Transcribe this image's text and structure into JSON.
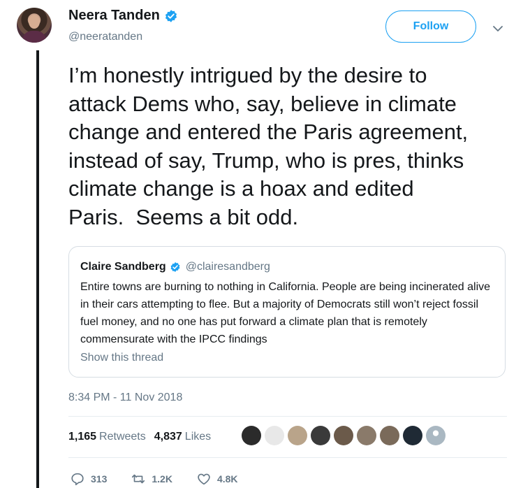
{
  "author": {
    "name": "Neera Tanden",
    "handle": "@neeratanden"
  },
  "follow_label": "Follow",
  "tweet_text": "I’m honestly intrigued by the desire to\nattack Dems who, say, believe in climate\nchange and entered the Paris agreement,\ninstead of say, Trump, who is pres, thinks\nclimate change is a hoax and edited\nParis.  Seems a bit odd.",
  "quote": {
    "name": "Claire Sandberg",
    "handle": "@clairesandberg",
    "text": "Entire towns are burning to nothing in California. People are being incinerated alive in their cars attempting to flee. But a majority of Democrats still won’t reject fossil fuel money, and no one has put forward a climate plan that is remotely commensurate with the IPCC findings",
    "thread_link": "Show this thread"
  },
  "timestamp": "8:34 PM - 11 Nov 2018",
  "stats": {
    "retweets_count": "1,165",
    "retweets_label": "Retweets",
    "likes_count": "4,837",
    "likes_label": "Likes"
  },
  "actions": {
    "replies": "313",
    "retweets": "1.2K",
    "likes": "4.8K"
  },
  "liker_avatar_colors": [
    "#2b2b2b",
    "#e8e8e8",
    "#b9a48a",
    "#3a3a3a",
    "#6b5a4a",
    "#8a7a6a",
    "#7a6a5a",
    "#1f2a35",
    "#aab8c2"
  ],
  "colors": {
    "accent": "#1da1f2",
    "secondary_text": "#657786",
    "border": "#e6ecf0"
  }
}
